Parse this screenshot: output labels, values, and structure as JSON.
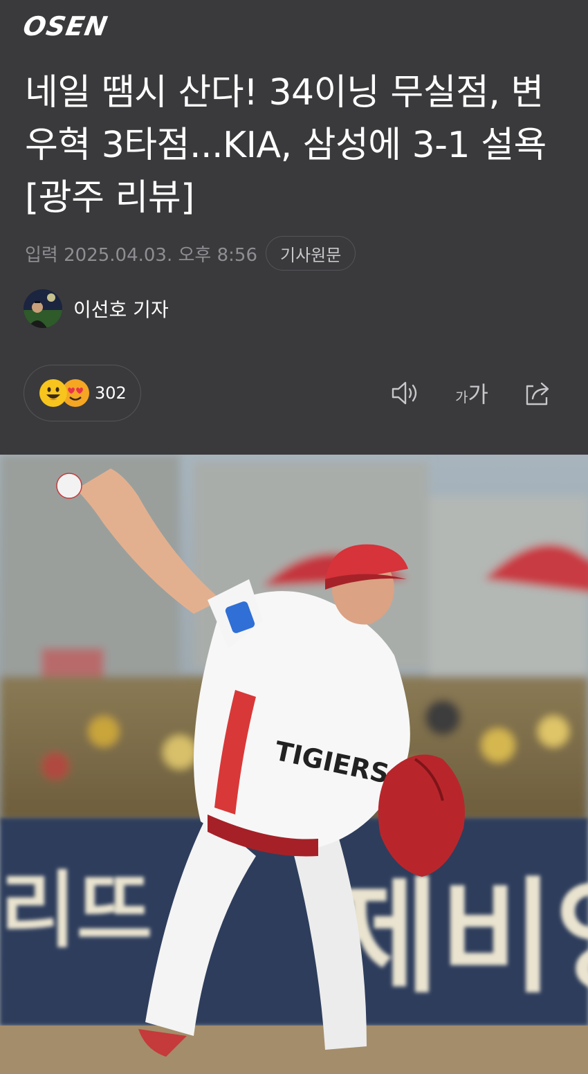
{
  "header": {
    "logo": "OSEN",
    "title": "네일 땜시 산다! 34이닝 무실점, 변우혁 3타점...KIA, 삼성에 3-1 설욕 [광주 리뷰]",
    "date": "입력 2025.04.03. 오후 8:56",
    "source_button": "기사원문",
    "author": "이선호 기자",
    "reaction_count": "302"
  },
  "icons": {
    "reaction_1": "grinning-face-icon",
    "reaction_2": "heart-eyes-face-icon",
    "speaker": "speaker-icon",
    "font_size": "font-size-icon",
    "font_size_glyph_small": "가",
    "font_size_glyph_large": "가",
    "share": "share-icon"
  },
  "photo": {
    "jersey_text": "TIGIERS",
    "banner_left": "리뜨",
    "banner_right": "제비잉"
  },
  "colors": {
    "header_bg": "#3a3a3c",
    "text_primary": "#ffffff",
    "text_secondary": "#8e8e93",
    "border": "#55555a"
  }
}
